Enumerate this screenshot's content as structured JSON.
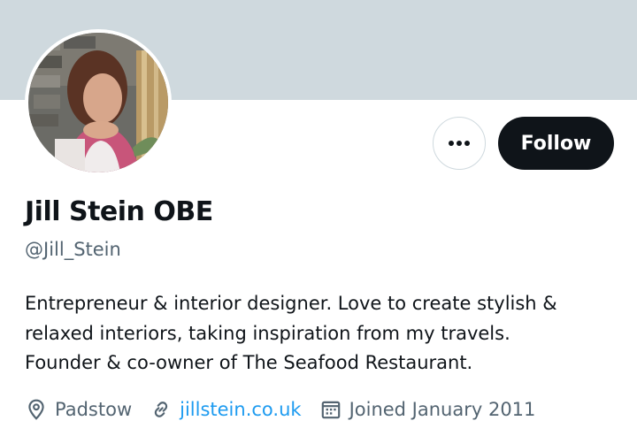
{
  "profile": {
    "name": "Jill Stein OBE",
    "handle": "@Jill_Stein",
    "bio_lines": [
      "Entrepreneur & interior designer. Love to create stylish &",
      "relaxed interiors, taking inspiration from my travels.",
      "Founder & co-owner of The Seafood Restaurant."
    ],
    "location": "Padstow",
    "website": "jillstein.co.uk",
    "joined": "Joined January 2011"
  },
  "actions": {
    "follow_label": "Follow",
    "more_icon": "more-horizontal-icon"
  },
  "icons": {
    "location": "location-pin-icon",
    "website": "link-icon",
    "joined": "calendar-icon"
  },
  "colors": {
    "banner": "#cfd9de",
    "follow_bg": "#0f1419",
    "link": "#1d9bf0",
    "secondary_text": "#536471"
  }
}
